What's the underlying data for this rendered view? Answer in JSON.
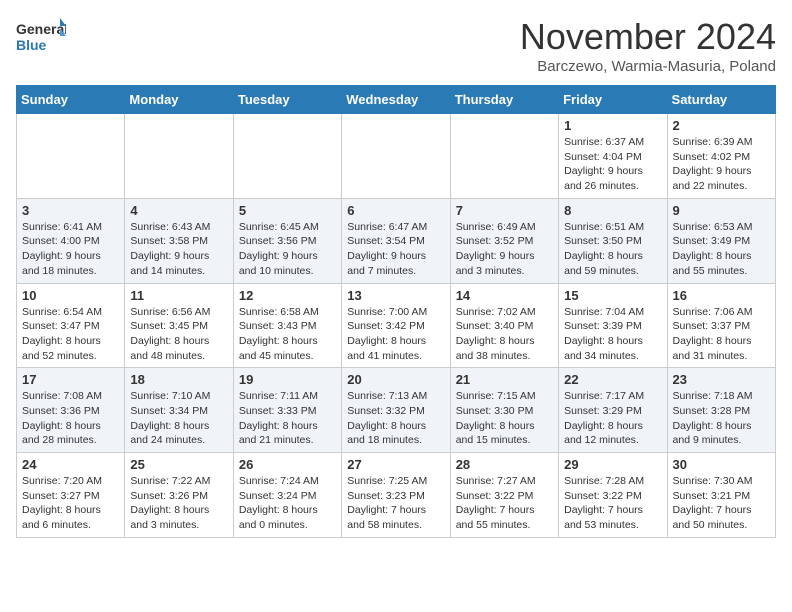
{
  "logo": {
    "line1": "General",
    "line2": "Blue"
  },
  "title": "November 2024",
  "location": "Barczewo, Warmia-Masuria, Poland",
  "days_of_week": [
    "Sunday",
    "Monday",
    "Tuesday",
    "Wednesday",
    "Thursday",
    "Friday",
    "Saturday"
  ],
  "weeks": [
    [
      {
        "day": "",
        "info": ""
      },
      {
        "day": "",
        "info": ""
      },
      {
        "day": "",
        "info": ""
      },
      {
        "day": "",
        "info": ""
      },
      {
        "day": "",
        "info": ""
      },
      {
        "day": "1",
        "info": "Sunrise: 6:37 AM\nSunset: 4:04 PM\nDaylight: 9 hours and 26 minutes."
      },
      {
        "day": "2",
        "info": "Sunrise: 6:39 AM\nSunset: 4:02 PM\nDaylight: 9 hours and 22 minutes."
      }
    ],
    [
      {
        "day": "3",
        "info": "Sunrise: 6:41 AM\nSunset: 4:00 PM\nDaylight: 9 hours and 18 minutes."
      },
      {
        "day": "4",
        "info": "Sunrise: 6:43 AM\nSunset: 3:58 PM\nDaylight: 9 hours and 14 minutes."
      },
      {
        "day": "5",
        "info": "Sunrise: 6:45 AM\nSunset: 3:56 PM\nDaylight: 9 hours and 10 minutes."
      },
      {
        "day": "6",
        "info": "Sunrise: 6:47 AM\nSunset: 3:54 PM\nDaylight: 9 hours and 7 minutes."
      },
      {
        "day": "7",
        "info": "Sunrise: 6:49 AM\nSunset: 3:52 PM\nDaylight: 9 hours and 3 minutes."
      },
      {
        "day": "8",
        "info": "Sunrise: 6:51 AM\nSunset: 3:50 PM\nDaylight: 8 hours and 59 minutes."
      },
      {
        "day": "9",
        "info": "Sunrise: 6:53 AM\nSunset: 3:49 PM\nDaylight: 8 hours and 55 minutes."
      }
    ],
    [
      {
        "day": "10",
        "info": "Sunrise: 6:54 AM\nSunset: 3:47 PM\nDaylight: 8 hours and 52 minutes."
      },
      {
        "day": "11",
        "info": "Sunrise: 6:56 AM\nSunset: 3:45 PM\nDaylight: 8 hours and 48 minutes."
      },
      {
        "day": "12",
        "info": "Sunrise: 6:58 AM\nSunset: 3:43 PM\nDaylight: 8 hours and 45 minutes."
      },
      {
        "day": "13",
        "info": "Sunrise: 7:00 AM\nSunset: 3:42 PM\nDaylight: 8 hours and 41 minutes."
      },
      {
        "day": "14",
        "info": "Sunrise: 7:02 AM\nSunset: 3:40 PM\nDaylight: 8 hours and 38 minutes."
      },
      {
        "day": "15",
        "info": "Sunrise: 7:04 AM\nSunset: 3:39 PM\nDaylight: 8 hours and 34 minutes."
      },
      {
        "day": "16",
        "info": "Sunrise: 7:06 AM\nSunset: 3:37 PM\nDaylight: 8 hours and 31 minutes."
      }
    ],
    [
      {
        "day": "17",
        "info": "Sunrise: 7:08 AM\nSunset: 3:36 PM\nDaylight: 8 hours and 28 minutes."
      },
      {
        "day": "18",
        "info": "Sunrise: 7:10 AM\nSunset: 3:34 PM\nDaylight: 8 hours and 24 minutes."
      },
      {
        "day": "19",
        "info": "Sunrise: 7:11 AM\nSunset: 3:33 PM\nDaylight: 8 hours and 21 minutes."
      },
      {
        "day": "20",
        "info": "Sunrise: 7:13 AM\nSunset: 3:32 PM\nDaylight: 8 hours and 18 minutes."
      },
      {
        "day": "21",
        "info": "Sunrise: 7:15 AM\nSunset: 3:30 PM\nDaylight: 8 hours and 15 minutes."
      },
      {
        "day": "22",
        "info": "Sunrise: 7:17 AM\nSunset: 3:29 PM\nDaylight: 8 hours and 12 minutes."
      },
      {
        "day": "23",
        "info": "Sunrise: 7:18 AM\nSunset: 3:28 PM\nDaylight: 8 hours and 9 minutes."
      }
    ],
    [
      {
        "day": "24",
        "info": "Sunrise: 7:20 AM\nSunset: 3:27 PM\nDaylight: 8 hours and 6 minutes."
      },
      {
        "day": "25",
        "info": "Sunrise: 7:22 AM\nSunset: 3:26 PM\nDaylight: 8 hours and 3 minutes."
      },
      {
        "day": "26",
        "info": "Sunrise: 7:24 AM\nSunset: 3:24 PM\nDaylight: 8 hours and 0 minutes."
      },
      {
        "day": "27",
        "info": "Sunrise: 7:25 AM\nSunset: 3:23 PM\nDaylight: 7 hours and 58 minutes."
      },
      {
        "day": "28",
        "info": "Sunrise: 7:27 AM\nSunset: 3:22 PM\nDaylight: 7 hours and 55 minutes."
      },
      {
        "day": "29",
        "info": "Sunrise: 7:28 AM\nSunset: 3:22 PM\nDaylight: 7 hours and 53 minutes."
      },
      {
        "day": "30",
        "info": "Sunrise: 7:30 AM\nSunset: 3:21 PM\nDaylight: 7 hours and 50 minutes."
      }
    ]
  ]
}
